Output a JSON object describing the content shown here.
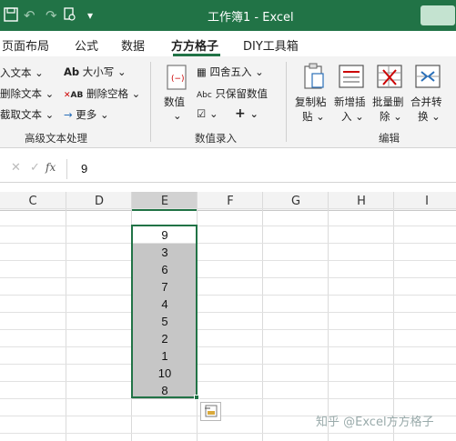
{
  "title": "工作簿1 - Excel",
  "quick_access": {
    "save_icon": "save-icon",
    "undo_icon": "undo-icon",
    "redo_icon": "redo-icon",
    "touch_icon": "touch-mode-icon",
    "more_icon": "customize-icon"
  },
  "tabs": [
    {
      "label": "页面布局"
    },
    {
      "label": "公式"
    },
    {
      "label": "数据"
    },
    {
      "label": "方方格子",
      "active": true
    },
    {
      "label": "DIY工具箱"
    }
  ],
  "ribbon": {
    "text_group": {
      "items": [
        "入文本",
        "删除文本",
        "截取文本"
      ],
      "case_label": "大小写",
      "remove_space_label": "删除空格",
      "more_label": "更多",
      "title": "高级文本处理"
    },
    "number_group": {
      "value_label": "数值",
      "round_label": "四舍五入",
      "keep_value_label": "只保留数值",
      "abc_label": "Abc",
      "title": "数值录入"
    },
    "edit_group": {
      "copy_paste_label": "复制粘",
      "copy_paste_label2": "贴",
      "insert_label": "新增插",
      "insert_label2": "入",
      "batch_delete_label": "批量删",
      "batch_delete_label2": "除",
      "merge_label": "合并转",
      "merge_label2": "换",
      "title": "编辑"
    }
  },
  "formula_bar": {
    "cancel": "✕",
    "confirm": "✓",
    "fx": "fx",
    "value": "9"
  },
  "columns": [
    "C",
    "D",
    "E",
    "F",
    "G",
    "H",
    "I"
  ],
  "cells_e": [
    "9",
    "3",
    "6",
    "7",
    "4",
    "5",
    "2",
    "1",
    "10",
    "8"
  ],
  "watermark": "知乎 @Excel方方格子",
  "colors": {
    "accent": "#217346",
    "selection_fill": "#c6c6c6"
  }
}
